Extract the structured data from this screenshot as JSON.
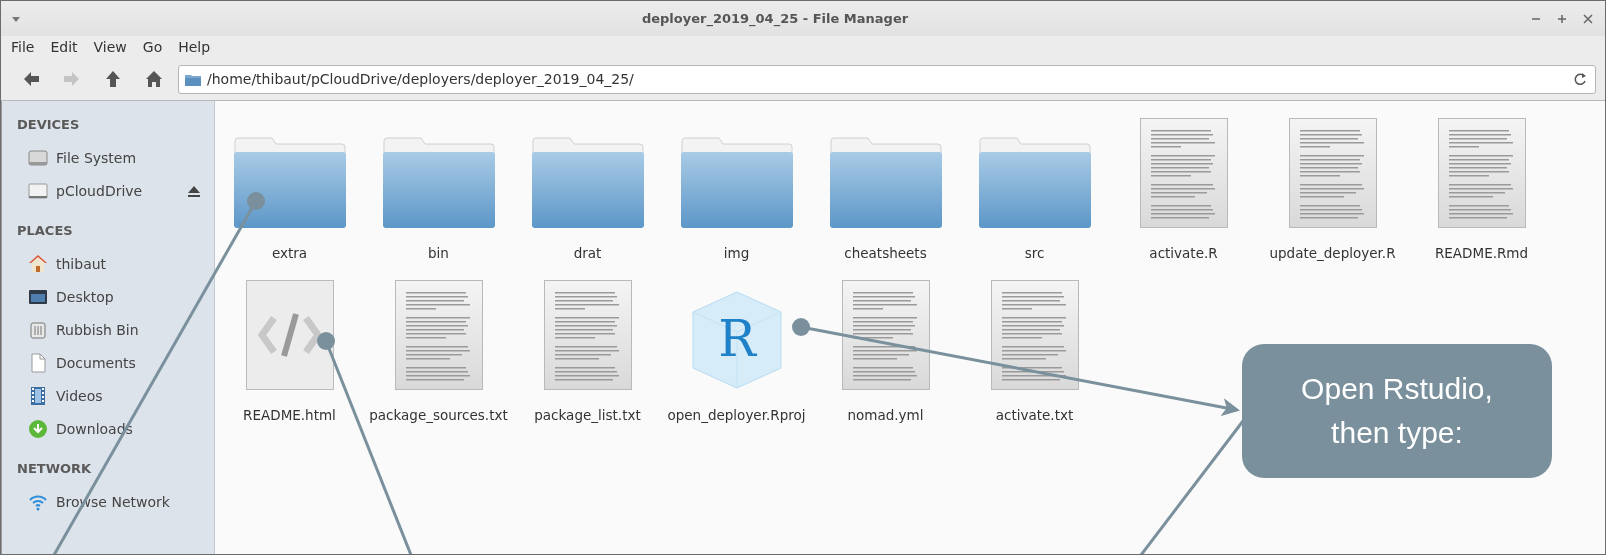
{
  "window": {
    "title": "deployer_2019_04_25 - File Manager"
  },
  "menu": [
    "File",
    "Edit",
    "View",
    "Go",
    "Help"
  ],
  "nav_buttons": [
    {
      "kind": "back",
      "disabled": false
    },
    {
      "kind": "forward",
      "disabled": true
    },
    {
      "kind": "up",
      "disabled": false
    },
    {
      "kind": "home",
      "disabled": false
    }
  ],
  "location": {
    "value": "/home/thibaut/pCloudDrive/deployers/deployer_2019_04_25/"
  },
  "sidebar": {
    "sections": [
      {
        "title": "DEVICES",
        "items": [
          {
            "label": "File System",
            "kind": "drive",
            "ejectable": false
          },
          {
            "label": "pCloudDrive",
            "kind": "removable",
            "ejectable": true
          }
        ]
      },
      {
        "title": "PLACES",
        "items": [
          {
            "label": "thibaut",
            "kind": "home",
            "ejectable": false
          },
          {
            "label": "Desktop",
            "kind": "desktop",
            "ejectable": false
          },
          {
            "label": "Rubbish Bin",
            "kind": "trash",
            "ejectable": false
          },
          {
            "label": "Documents",
            "kind": "documents",
            "ejectable": false
          },
          {
            "label": "Videos",
            "kind": "videos",
            "ejectable": false
          },
          {
            "label": "Downloads",
            "kind": "downloads",
            "ejectable": false
          }
        ]
      },
      {
        "title": "NETWORK",
        "items": [
          {
            "label": "Browse Network",
            "kind": "network",
            "ejectable": false
          }
        ]
      }
    ]
  },
  "files": [
    {
      "name": "extra",
      "kind": "folder"
    },
    {
      "name": "bin",
      "kind": "folder"
    },
    {
      "name": "drat",
      "kind": "folder"
    },
    {
      "name": "img",
      "kind": "folder"
    },
    {
      "name": "cheatsheets",
      "kind": "folder"
    },
    {
      "name": "src",
      "kind": "folder"
    },
    {
      "name": "activate.R",
      "kind": "text"
    },
    {
      "name": "update_deployer.R",
      "kind": "text"
    },
    {
      "name": "README.Rmd",
      "kind": "text"
    },
    {
      "name": "README.html",
      "kind": "html"
    },
    {
      "name": "package_sources.txt",
      "kind": "text"
    },
    {
      "name": "package_list.txt",
      "kind": "text"
    },
    {
      "name": "open_deployer.Rproj",
      "kind": "rproj",
      "icon_text": "R"
    },
    {
      "name": "nomad.yml",
      "kind": "text"
    },
    {
      "name": "activate.txt",
      "kind": "text"
    }
  ],
  "callout": {
    "text": "Open Rstudio, then type:"
  }
}
